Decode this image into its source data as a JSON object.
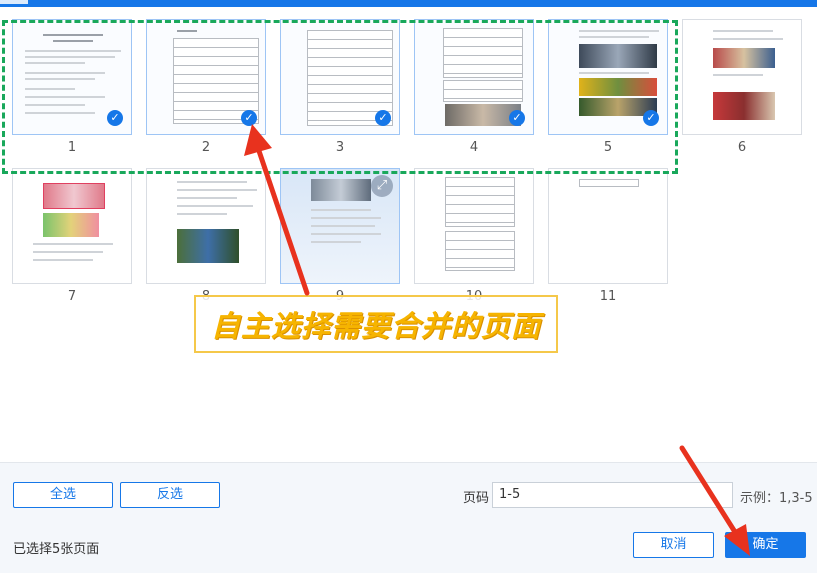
{
  "thumbnails": [
    {
      "num": "1"
    },
    {
      "num": "2"
    },
    {
      "num": "3"
    },
    {
      "num": "4"
    },
    {
      "num": "5"
    },
    {
      "num": "6"
    },
    {
      "num": "7"
    },
    {
      "num": "8"
    },
    {
      "num": "9"
    },
    {
      "num": "10"
    },
    {
      "num": "11"
    }
  ],
  "selected_pages": [
    1,
    2,
    3,
    4,
    5
  ],
  "annotation": {
    "text": "自主选择需要合并的页面"
  },
  "bottom": {
    "select_all": "全选",
    "invert_select": "反选",
    "page_label": "页码",
    "page_value": "1-5",
    "example": "示例：1,3-5",
    "status": "已选择5张页面",
    "cancel": "取消",
    "confirm": "确定"
  },
  "colors": {
    "accent": "#1677e8",
    "frame": "#19a85b",
    "arrow": "#e8321e",
    "highlight": "#f6b400"
  }
}
